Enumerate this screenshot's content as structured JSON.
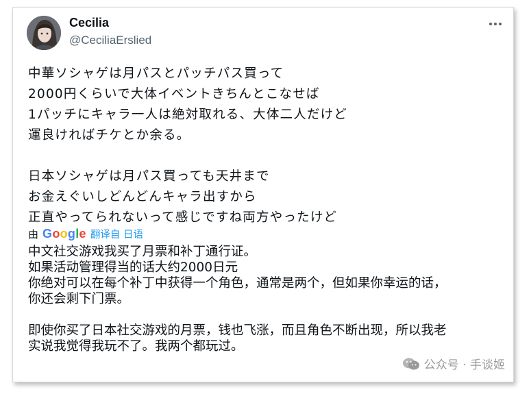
{
  "post": {
    "display_name": "Cecilia",
    "handle": "@CeciliaErslied",
    "more_label": "···",
    "original_lines": [
      "中華ソシャゲは月パスとパッチパス買って",
      "2000円くらいで大体イベントきちんとこなせば",
      "1パッチにキャラ一人は絶対取れる、大体二人だけど",
      "運良ければチケとか余る。",
      "",
      "日本ソシャゲは月パス買っても天井まで",
      "お金えぐいしどんどんキャラ出すから",
      "正直やってられないって感じですね両方やったけど"
    ],
    "translated_by": {
      "prefix": "由",
      "logo": {
        "G": "G",
        "o1": "o",
        "o2": "o",
        "g": "g",
        "l": "l",
        "e": "e"
      },
      "link": "翻译自 日语"
    },
    "translation_lines": [
      "中文社交游戏我买了月票和补丁通行证。",
      "如果活动管理得当的话大约2000日元",
      "你绝对可以在每个补丁中获得一个角色，通常是两个，但如果你幸运的话，",
      "你还会剩下门票。",
      "",
      "即使你买了日本社交游戏的月票，钱也飞涨，而且角色不断出现，所以我老",
      "实说我觉得我玩不了。我两个都玩过。"
    ]
  },
  "watermark": {
    "text": "公众号 · 手谈姬",
    "icon": "wechat-icon"
  },
  "colors": {
    "link": "#1d9bf0",
    "handle": "#536471",
    "text": "#0f1419"
  }
}
